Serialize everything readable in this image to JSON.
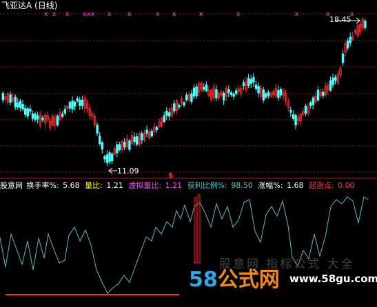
{
  "window": {
    "title": "飞亚达A (日线)"
  },
  "main_chart": {
    "high_label": "18.45",
    "low_label": "11.09",
    "signal_mark": "$"
  },
  "indicator": {
    "name": "股意网",
    "fields": [
      {
        "label": "换手率%:",
        "value": "5.68",
        "color": "#ffffff"
      },
      {
        "label": "量比:",
        "value": "1.21",
        "color": "#ffff00"
      },
      {
        "label": "虚拟量比:",
        "value": "1.21",
        "color": "#ff44ff"
      },
      {
        "label": "获利比例%:",
        "value": "98.50",
        "color": "#44c8c8"
      },
      {
        "label": "涨幅%:",
        "value": "1.68",
        "color": "#ffffff"
      },
      {
        "label": "起涨点:",
        "value": "0.00",
        "color": "#ff4040"
      }
    ]
  },
  "watermark": {
    "text": "股意网 指标公式 大全",
    "logo_num": "58",
    "logo_text": "公式网",
    "url": "www.58gu.com",
    "sub": "www.58gu.com"
  },
  "colors": {
    "up": "#ff3232",
    "down": "#54ffff",
    "grid": "#8b1a1a",
    "separator": "#b02020",
    "indicator_line": "#5fb8c8",
    "marker": "#ff44ff"
  }
}
